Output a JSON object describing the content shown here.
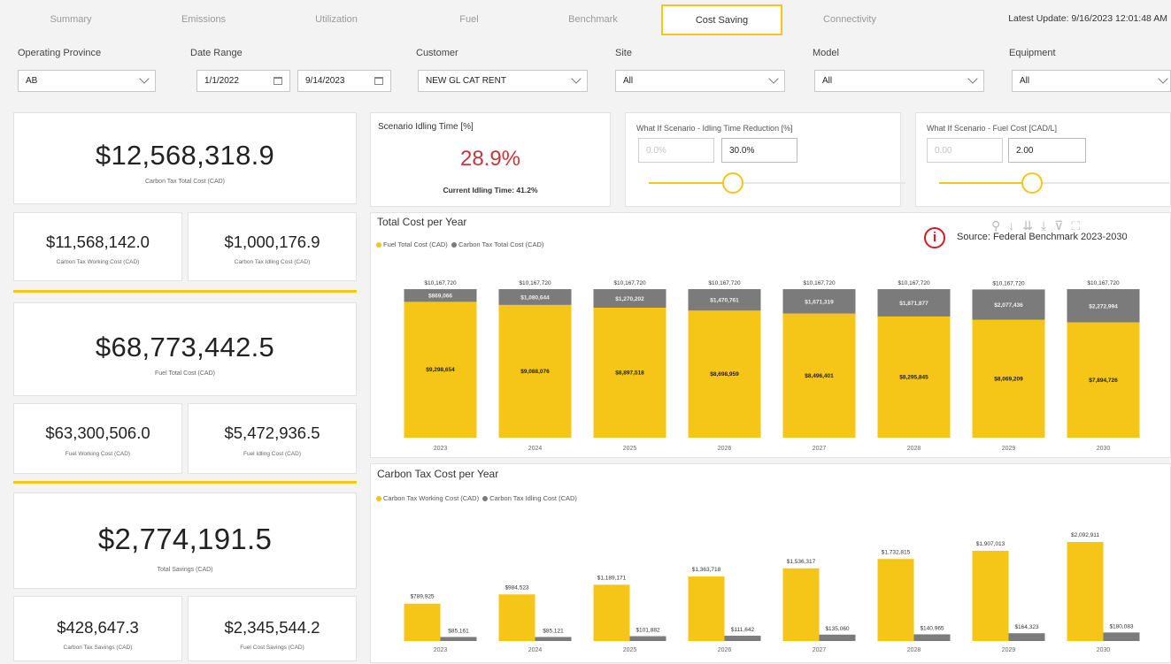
{
  "nav": {
    "tabs": [
      "Summary",
      "Emissions",
      "Utilization",
      "Fuel",
      "Benchmark",
      "Cost Saving",
      "Connectivity"
    ],
    "active_tab": "Cost Saving",
    "last_update": "Latest Update: 9/16/2023 12:01:48 AM"
  },
  "filters": {
    "province": {
      "label": "Operating Province",
      "value": "AB"
    },
    "date_range": {
      "label": "Date Range",
      "start": "1/1/2022",
      "end": "9/14/2023"
    },
    "customer": {
      "label": "Customer",
      "value": "NEW GL CAT RENT"
    },
    "site": {
      "label": "Site",
      "value": "All"
    },
    "model": {
      "label": "Model",
      "value": "All"
    },
    "equipment": {
      "label": "Equipment",
      "value": "All"
    }
  },
  "kpis": {
    "carbon_total": {
      "value": "$12,568,318.9",
      "label": "Carbon Tax Total Cost (CAD)"
    },
    "carbon_working": {
      "value": "$11,568,142.0",
      "label": "Carbon Tax Working Cost (CAD)"
    },
    "carbon_idling": {
      "value": "$1,000,176.9",
      "label": "Carbon Tax Idling Cost (CAD)"
    },
    "fuel_total": {
      "value": "$68,773,442.5",
      "label": "Fuel Total Cost (CAD)"
    },
    "fuel_working": {
      "value": "$63,300,506.0",
      "label": "Fuel Working Cost (CAD)"
    },
    "fuel_idling": {
      "value": "$5,472,936.5",
      "label": "Fuel Idling Cost (CAD)"
    },
    "total_savings": {
      "value": "$2,774,191.5",
      "label": "Total Savings (CAD)"
    },
    "carbon_savings": {
      "value": "$428,647.3",
      "label": "Carbon Tax Savings (CAD)"
    },
    "fuel_savings": {
      "value": "$2,345,544.2",
      "label": "Fuel Cost Savings (CAD)"
    }
  },
  "scenario": {
    "title": "Scenario Idling Time [%]",
    "value": "28.9%",
    "current": "Current Idling Time: 41.2%"
  },
  "idle_slicer": {
    "title": "What If Scenario - Idling Time Reduction [%]",
    "min": "0.0%",
    "value": "30.0%",
    "level": 0.5
  },
  "fuel_slicer": {
    "title": "What If Scenario - Fuel Cost [CAD/L]",
    "min": "0.00",
    "value": "2.00",
    "level": 0.5
  },
  "source_note": "Source: Federal Benchmark 2023-2030",
  "colors": {
    "accent": "#f5c518",
    "gray": "#7b7b7b",
    "value_red": "#c8353d",
    "info_red": "#d71920"
  },
  "chart_data": [
    {
      "type": "bar",
      "stacked": true,
      "title": "Total Cost per Year",
      "categories": [
        "2023",
        "2024",
        "2025",
        "2026",
        "2027",
        "2028",
        "2029",
        "2030"
      ],
      "total_labels": [
        "$10,167,720",
        "$10,167,720",
        "$10,167,720",
        "$10,167,720",
        "$10,167,720",
        "$10,167,720",
        "$10,167,720",
        "$10,167,720"
      ],
      "series": [
        {
          "name": "Fuel Total Cost (CAD)",
          "color": "#f5c518",
          "values": [
            9298654,
            9088076,
            8897518,
            8698959,
            8496401,
            8295845,
            8069209,
            7894726
          ],
          "labels": [
            "$9,298,654",
            "$9,088,076",
            "$8,897,518",
            "$8,698,959",
            "$8,496,401",
            "$8,295,845",
            "$8,069,209",
            "$7,894,726"
          ]
        },
        {
          "name": "Carbon Tax Total Cost (CAD)",
          "color": "#7b7b7b",
          "values": [
            869066,
            1080644,
            1270202,
            1470761,
            1671319,
            1871877,
            2077436,
            2272994
          ],
          "labels": [
            "$869,066",
            "$1,080,644",
            "$1,270,202",
            "$1,470,761",
            "$1,671,319",
            "$1,871,877",
            "$2,077,436",
            "$2,272,994"
          ]
        }
      ]
    },
    {
      "type": "bar",
      "title": "Carbon Tax Cost per Year",
      "categories": [
        "2023",
        "2024",
        "2025",
        "2026",
        "2027",
        "2028",
        "2029",
        "2030"
      ],
      "series": [
        {
          "name": "Carbon Tax Working Cost (CAD)",
          "color": "#f5c518",
          "values": [
            789925,
            984523,
            1189171,
            1363718,
            1536317,
            1732815,
            1907013,
            2092911
          ],
          "labels": [
            "$789,925",
            "$984,523",
            "$1,189,171",
            "$1,363,718",
            "$1,536,317",
            "$1,732,815",
            "$1,907,013",
            "$2,092,911"
          ]
        },
        {
          "name": "Carbon Tax Idling Cost (CAD)",
          "color": "#7b7b7b",
          "values": [
            85161,
            85121,
            101882,
            111642,
            135060,
            140965,
            164323,
            180083
          ],
          "labels": [
            "$85,161",
            "$85,121",
            "$101,882",
            "$111,642",
            "$135,060",
            "$140,965",
            "$164,323",
            "$180,083"
          ]
        }
      ]
    }
  ]
}
